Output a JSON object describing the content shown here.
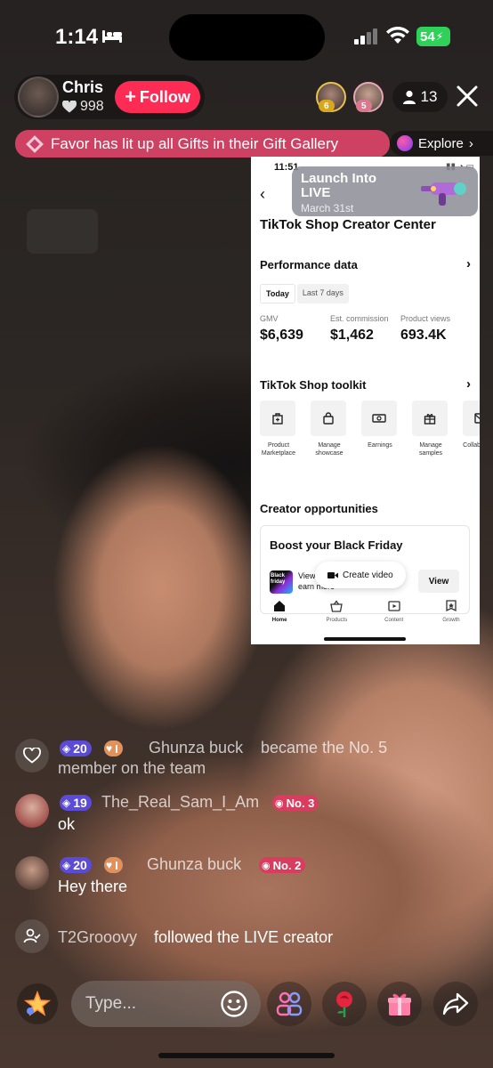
{
  "status_bar": {
    "time": "1:14",
    "battery": "54"
  },
  "host": {
    "name": "Chris",
    "likes": "998",
    "follow_label": "Follow"
  },
  "top_viewers": [
    {
      "rank": "6"
    },
    {
      "rank": "5"
    }
  ],
  "viewer_count": "13",
  "banner": {
    "text": "Favor has lit up all Gifts in their Gift Gallery",
    "explore_label": "Explore"
  },
  "screen_share": {
    "time": "11:51",
    "launch_card": {
      "title": "Launch Into LIVE",
      "date": "March 31st"
    },
    "title": "TikTok Shop Creator Center",
    "performance": {
      "heading": "Performance data",
      "tabs": [
        "Today",
        "Last 7 days"
      ],
      "metrics": [
        {
          "label": "GMV",
          "value": "$6,639"
        },
        {
          "label": "Est. commission",
          "value": "$1,462"
        },
        {
          "label": "Product views",
          "value": "693.4K"
        }
      ]
    },
    "toolkit": {
      "heading": "TikTok Shop toolkit",
      "tools": [
        {
          "label": "Product Marketplace",
          "icon": "store-icon"
        },
        {
          "label": "Manage showcase",
          "icon": "bag-icon"
        },
        {
          "label": "Earnings",
          "icon": "money-icon"
        },
        {
          "label": "Manage samples",
          "icon": "gift-icon"
        },
        {
          "label": "Collab invites",
          "icon": "invite-icon"
        }
      ]
    },
    "opportunities": {
      "heading": "Creator opportunities",
      "card_title": "Boost your Black Friday",
      "thumb_label": "Black friday",
      "card_text": "View challenges to earn more",
      "view_label": "View",
      "create_video_label": "Create video"
    },
    "nav": [
      "Home",
      "Products",
      "Content",
      "Growth"
    ]
  },
  "chat": [
    {
      "type": "system",
      "level": "20",
      "heart_level": "I",
      "name": "Ghunza buck",
      "text": "became the No. 5",
      "text_line2": "member on the team"
    },
    {
      "type": "comment",
      "level": "19",
      "name": "The_Real_Sam_I_Am",
      "rank": "No. 3",
      "text": "ok"
    },
    {
      "type": "comment",
      "level": "20",
      "heart_level": "I",
      "name": "Ghunza buck",
      "rank": "No. 2",
      "text": "Hey there"
    },
    {
      "type": "follow",
      "name": "T2Grooovy",
      "text": "followed the LIVE creator"
    }
  ],
  "input": {
    "placeholder": "Type..."
  },
  "colors": {
    "accent": "#fe2c55",
    "battery": "#30d158",
    "level_badge": "#5b4bd6"
  }
}
